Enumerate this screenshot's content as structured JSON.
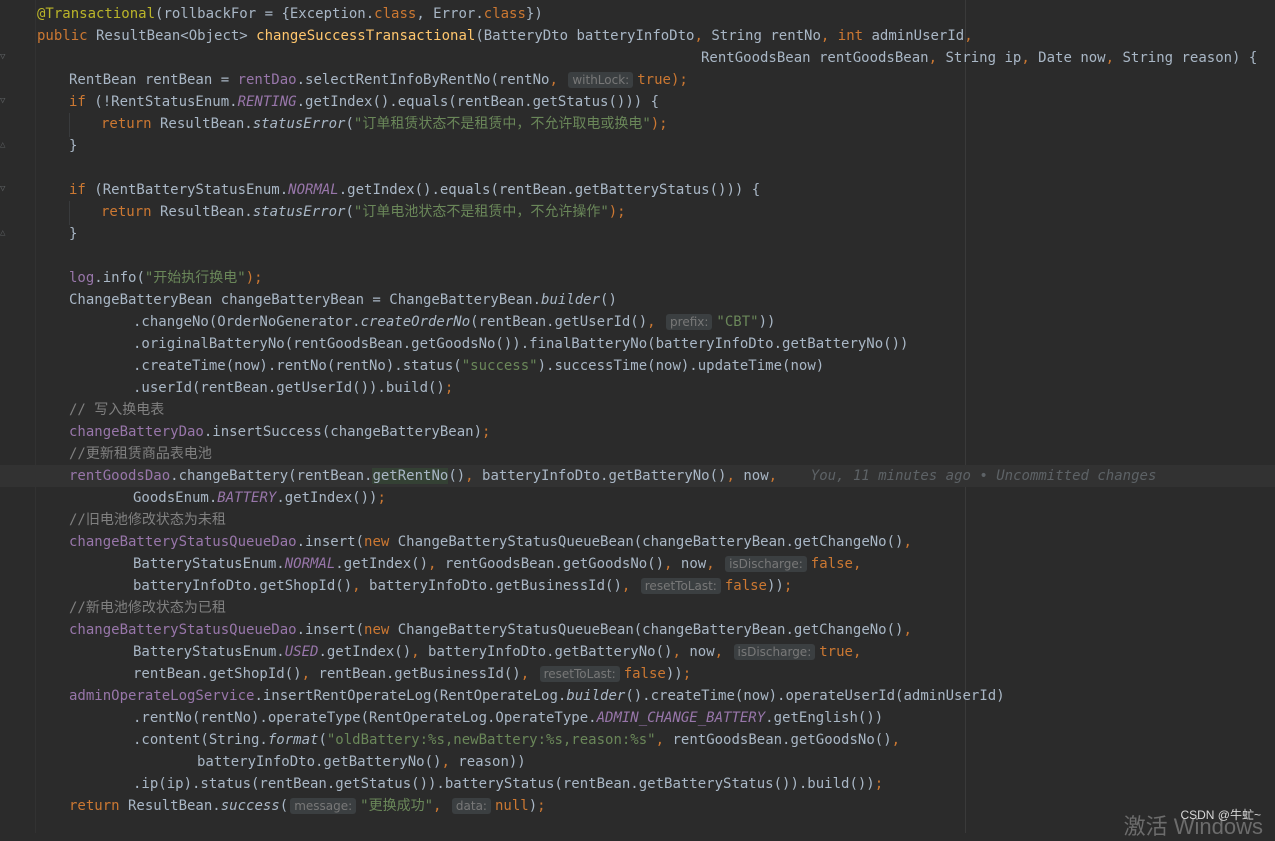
{
  "colors": {
    "background": "#2b2b2b",
    "keyword": "#cc7832",
    "annotation": "#bbb529",
    "method_declaration": "#ffc66d",
    "string": "#6a8759",
    "field": "#9876aa",
    "comment": "#808080",
    "default_text": "#a9b7c6"
  },
  "code": {
    "l1_ann": "@Transactional",
    "l1_a": "(rollbackFor = {Exception.",
    "l1_k1": "class",
    "l1_b": ", Error.",
    "l1_k2": "class",
    "l1_c": "})",
    "l2_k1": "public",
    "l2_a": " ResultBean<Object> ",
    "l2_fn": "changeSuccessTransactional",
    "l2_b": "(BatteryDto batteryInfoDto",
    "l2_comma1": ",",
    "l2_c": " String rentNo",
    "l2_comma2": ",",
    "l2_k2": " int",
    "l2_d": " adminUserId",
    "l2_comma3": ",",
    "l3_a": "RentGoodsBean rentGoodsBean",
    "l3_comma1": ",",
    "l3_b": " String ip",
    "l3_comma2": ",",
    "l3_c": " Date now",
    "l3_comma3": ",",
    "l3_d": " String reason) {",
    "l4_a": "RentBean rentBean = ",
    "l4_field": "rentDao",
    "l4_b": ".selectRentInfoByRentNo(rentNo",
    "l4_comma": ",",
    "l4_hint": "withLock:",
    "l4_k": "true",
    "l4_c": ");",
    "l5_k": "if",
    "l5_a": " (!RentStatusEnum.",
    "l5_field": "RENTING",
    "l5_b": ".getIndex().equals(rentBean.getStatus())) {",
    "l6_k": "return",
    "l6_a": " ResultBean.",
    "l6_it": "statusError",
    "l6_b": "(",
    "l6_str": "\"订单租赁状态不是租赁中，不允许取电或换电\"",
    "l6_c": ");",
    "l7": "}",
    "l9_k": "if",
    "l9_a": " (RentBatteryStatusEnum.",
    "l9_field": "NORMAL",
    "l9_b": ".getIndex().equals(rentBean.getBatteryStatus())) {",
    "l10_k": "return",
    "l10_a": " ResultBean.",
    "l10_it": "statusError",
    "l10_b": "(",
    "l10_str": "\"订单电池状态不是租赁中，不允许操作\"",
    "l10_c": ");",
    "l11": "}",
    "l13_field": "log",
    "l13_a": ".info(",
    "l13_str": "\"开始执行换电\"",
    "l13_b": ");",
    "l14_a": "ChangeBatteryBean changeBatteryBean = ChangeBatteryBean.",
    "l14_it": "builder",
    "l14_b": "()",
    "l15_a": ".changeNo(OrderNoGenerator.",
    "l15_it": "createOrderNo",
    "l15_b": "(rentBean.getUserId()",
    "l15_comma": ",",
    "l15_hint": "prefix:",
    "l15_str": "\"CBT\"",
    "l15_c": "))",
    "l16": ".originalBatteryNo(rentGoodsBean.getGoodsNo()).finalBatteryNo(batteryInfoDto.getBatteryNo())",
    "l17_a": ".createTime(now).rentNo(rentNo).status(",
    "l17_str": "\"success\"",
    "l17_b": ").successTime(now).updateTime(now)",
    "l18_a": ".userId(rentBean.getUserId()).build()",
    "l18_semi": ";",
    "l19_cm": "// 写入换电表",
    "l20_field": "changeBatteryDao",
    "l20_a": ".insertSuccess(changeBatteryBean)",
    "l20_semi": ";",
    "l21_cm": "//更新租赁商品表电池",
    "l22_field": "rentGoodsDao",
    "l22_a": ".changeBattery(rentBean.",
    "l22_ref": "getRentNo",
    "l22_b": "()",
    "l22_comma1": ",",
    "l22_c": " batteryInfoDto.getBatteryNo()",
    "l22_comma2": ",",
    "l22_d": " now",
    "l22_comma3": ",",
    "l22_blame": "You, 11 minutes ago • Uncommitted changes",
    "l23_a": "GoodsEnum.",
    "l23_field": "BATTERY",
    "l23_b": ".getIndex())",
    "l23_semi": ";",
    "l24_cm": "//旧电池修改状态为未租",
    "l25_field": "changeBatteryStatusQueueDao",
    "l25_a": ".insert(",
    "l25_k": "new",
    "l25_b": " ChangeBatteryStatusQueueBean(changeBatteryBean.getChangeNo()",
    "l25_comma": ",",
    "l26_a": "BatteryStatusEnum.",
    "l26_field": "NORMAL",
    "l26_b": ".getIndex()",
    "l26_comma1": ",",
    "l26_c": " rentGoodsBean.getGoodsNo()",
    "l26_comma2": ",",
    "l26_d": " now",
    "l26_comma3": ",",
    "l26_hint": "isDischarge:",
    "l26_k": "false",
    "l26_comma4": ",",
    "l27_a": "batteryInfoDto.getShopId()",
    "l27_comma1": ",",
    "l27_b": " batteryInfoDto.getBusinessId()",
    "l27_comma2": ",",
    "l27_hint": "resetToLast:",
    "l27_k": "false",
    "l27_c": "))",
    "l27_semi": ";",
    "l28_cm": "//新电池修改状态为已租",
    "l29_field": "changeBatteryStatusQueueDao",
    "l29_a": ".insert(",
    "l29_k": "new",
    "l29_b": " ChangeBatteryStatusQueueBean(changeBatteryBean.getChangeNo()",
    "l29_comma": ",",
    "l30_a": "BatteryStatusEnum.",
    "l30_field": "USED",
    "l30_b": ".getIndex()",
    "l30_comma1": ",",
    "l30_c": " batteryInfoDto.getBatteryNo()",
    "l30_comma2": ",",
    "l30_d": " now",
    "l30_comma3": ",",
    "l30_hint": "isDischarge:",
    "l30_k": "true",
    "l30_comma4": ",",
    "l31_a": "rentBean.getShopId()",
    "l31_comma1": ",",
    "l31_b": " rentBean.getBusinessId()",
    "l31_comma2": ",",
    "l31_hint": "resetToLast:",
    "l31_k": "false",
    "l31_c": "))",
    "l31_semi": ";",
    "l32_field": "adminOperateLogService",
    "l32_a": ".insertRentOperateLog(RentOperateLog.",
    "l32_it": "builder",
    "l32_b": "().createTime(now).operateUserId(adminUserId)",
    "l33_a": ".rentNo(rentNo).operateType(RentOperateLog.OperateType.",
    "l33_field": "ADMIN_CHANGE_BATTERY",
    "l33_b": ".getEnglish())",
    "l34_a": ".content(String.",
    "l34_it": "format",
    "l34_b": "(",
    "l34_str": "\"oldBattery:%s,newBattery:%s,reason:%s\"",
    "l34_comma1": ",",
    "l34_c": " rentGoodsBean.getGoodsNo()",
    "l34_comma2": ",",
    "l35_a": "batteryInfoDto.getBatteryNo()",
    "l35_comma": ",",
    "l35_b": " reason))",
    "l36_a": ".ip(ip).status(rentBean.getStatus()).batteryStatus(rentBean.getBatteryStatus()).build())",
    "l36_semi": ";",
    "l37_k": "return",
    "l37_a": " ResultBean.",
    "l37_it": "success",
    "l37_b": "(",
    "l37_hint1": "message:",
    "l37_str": "\"更换成功\"",
    "l37_comma": ",",
    "l37_hint2": "data:",
    "l37_k2": "null",
    "l37_c": ")",
    "l37_semi": ";"
  },
  "watermark": {
    "csdn": "CSDN @牛虻~",
    "windows": "激活 Windows"
  }
}
